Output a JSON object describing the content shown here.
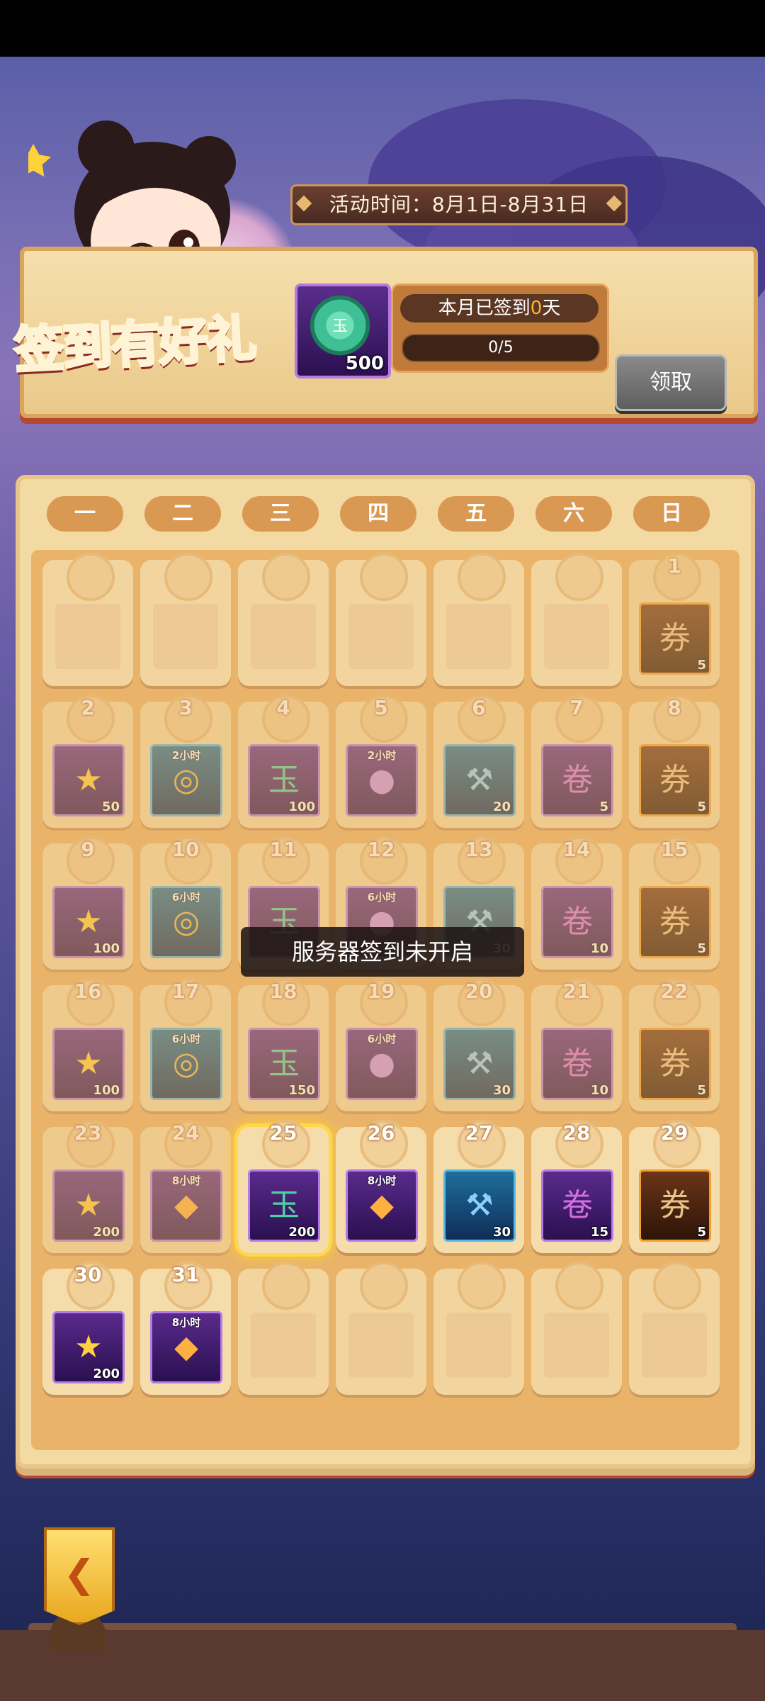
{
  "header": {
    "activity_time": "活动时间：8月1日-8月31日",
    "title": "签到有好礼",
    "reward_count": "500",
    "signed_prefix": "本月已签到",
    "signed_days": "0",
    "signed_suffix": "天",
    "progress": "0/5",
    "claim_label": "领取"
  },
  "weekdays": [
    "一",
    "二",
    "三",
    "四",
    "五",
    "六",
    "日"
  ],
  "toast": "服务器签到未开启",
  "days": [
    {
      "day": "1",
      "qty": "5",
      "icon": "ticket-icon"
    },
    {
      "day": "2",
      "qty": "50",
      "icon": "star-icon"
    },
    {
      "day": "3",
      "hours": "2小时",
      "icon": "coins-icon"
    },
    {
      "day": "4",
      "qty": "100",
      "icon": "jade-coin-icon"
    },
    {
      "day": "5",
      "hours": "2小时",
      "icon": "orb-icon"
    },
    {
      "day": "6",
      "qty": "20",
      "icon": "hammer-icon"
    },
    {
      "day": "7",
      "qty": "5",
      "icon": "scroll-icon"
    },
    {
      "day": "8",
      "qty": "5",
      "icon": "ticket-icon"
    },
    {
      "day": "9",
      "qty": "100",
      "icon": "star-icon"
    },
    {
      "day": "10",
      "hours": "6小时",
      "icon": "coins-icon"
    },
    {
      "day": "11",
      "icon": "jade-coin-icon"
    },
    {
      "day": "12",
      "hours": "6小时",
      "icon": "orb-icon"
    },
    {
      "day": "13",
      "qty": "30",
      "icon": "hammer-icon"
    },
    {
      "day": "14",
      "qty": "10",
      "icon": "scroll-icon"
    },
    {
      "day": "15",
      "qty": "5",
      "icon": "ticket-icon"
    },
    {
      "day": "16",
      "qty": "100",
      "icon": "star-icon"
    },
    {
      "day": "17",
      "hours": "6小时",
      "icon": "coins-icon"
    },
    {
      "day": "18",
      "qty": "150",
      "icon": "jade-coin-icon"
    },
    {
      "day": "19",
      "hours": "6小时",
      "icon": "orb-icon"
    },
    {
      "day": "20",
      "qty": "30",
      "icon": "hammer-icon"
    },
    {
      "day": "21",
      "qty": "10",
      "icon": "scroll-icon"
    },
    {
      "day": "22",
      "qty": "5",
      "icon": "ticket-icon"
    },
    {
      "day": "23",
      "qty": "200",
      "icon": "star-icon"
    },
    {
      "day": "24",
      "hours": "8小时",
      "icon": "bag-icon"
    },
    {
      "day": "25",
      "qty": "200",
      "icon": "jade-coin-icon"
    },
    {
      "day": "26",
      "hours": "8小时",
      "icon": "bag-icon"
    },
    {
      "day": "27",
      "qty": "30",
      "icon": "hammer-icon"
    },
    {
      "day": "28",
      "qty": "15",
      "icon": "scroll-icon"
    },
    {
      "day": "29",
      "qty": "5",
      "icon": "ticket-icon"
    },
    {
      "day": "30",
      "qty": "200",
      "icon": "star-icon"
    },
    {
      "day": "31",
      "hours": "8小时",
      "icon": "bag-icon"
    }
  ]
}
